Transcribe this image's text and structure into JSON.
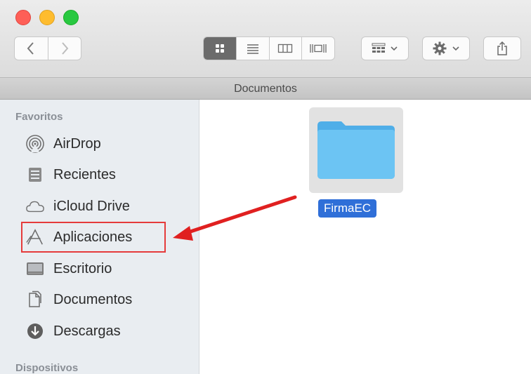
{
  "window": {
    "title": "Documentos"
  },
  "toolbar": {
    "back_icon": "chevron-left-icon",
    "forward_icon": "chevron-right-icon",
    "views": [
      "icon-view",
      "list-view",
      "column-view",
      "gallery-view"
    ],
    "arrange_icon": "grid-arrange-icon",
    "action_icon": "gear-icon",
    "share_icon": "share-icon"
  },
  "sidebar": {
    "favorites_title": "Favoritos",
    "devices_title": "Dispositivos",
    "items": [
      {
        "label": "AirDrop",
        "icon": "airdrop-icon"
      },
      {
        "label": "Recientes",
        "icon": "recents-icon"
      },
      {
        "label": "iCloud Drive",
        "icon": "cloud-icon"
      },
      {
        "label": "Aplicaciones",
        "icon": "applications-icon"
      },
      {
        "label": "Escritorio",
        "icon": "desktop-icon"
      },
      {
        "label": "Documentos",
        "icon": "documents-icon"
      },
      {
        "label": "Descargas",
        "icon": "downloads-icon"
      }
    ]
  },
  "content": {
    "folder": {
      "name": "FirmaEC",
      "icon": "folder-icon"
    }
  },
  "colors": {
    "highlight": "#e53b3b",
    "arrow": "#e02020",
    "selection": "#2f6fd8",
    "folder": "#5ab8ee"
  }
}
